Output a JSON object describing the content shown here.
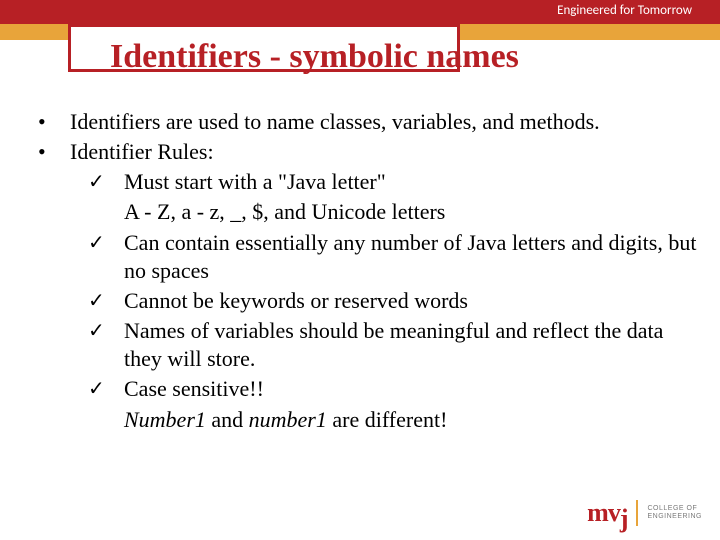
{
  "header": {
    "tagline": "Engineered for Tomorrow",
    "title": "Identifiers - symbolic names"
  },
  "bullets": [
    "Identifiers are used to name classes,  variables, and methods.",
    "Identifier Rules:"
  ],
  "checks": [
    {
      "main": "Must start with a \"Java letter\"",
      "sub": "A - Z, a - z, _, $, and Unicode letters"
    },
    {
      "main": "Can contain essentially any number of Java letters and digits, but no spaces"
    },
    {
      "main": "Cannot be keywords or reserved words"
    },
    {
      "main": "Names of variables should be meaningful and reflect the data they will store."
    },
    {
      "main": "Case sensitive!!",
      "sub_italic_parts": {
        "a": "Number1",
        "mid": " and ",
        "b": "number1",
        "tail": " are different!"
      }
    }
  ],
  "footer": {
    "logo_m": "m",
    "logo_v": "v",
    "logo_j": "j",
    "logo_line1": "COLLEGE OF",
    "logo_line2": "ENGINEERING"
  },
  "marks": {
    "bullet": "•",
    "check": "✓"
  }
}
